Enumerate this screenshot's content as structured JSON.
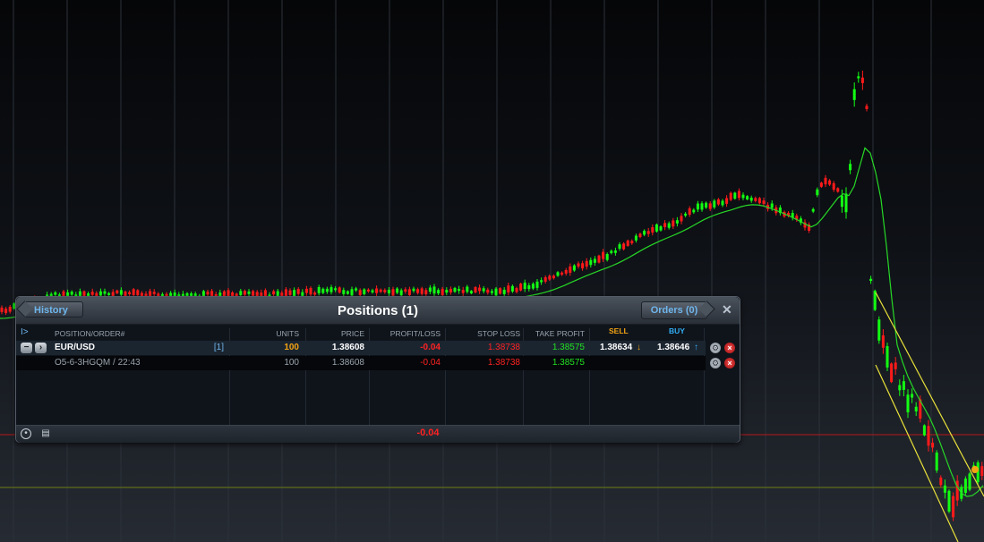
{
  "chart": {
    "background_top": "#050608",
    "background_bottom": "#262b33",
    "up_color": "#13ff13",
    "down_color": "#ff1a1a",
    "ma_color": "#27d827",
    "channel_color": "#e9e23b",
    "ref_line_red": "#c41818",
    "ref_line_olive": "#6f7d15"
  },
  "panel": {
    "history_label": "History",
    "title": "Positions (1)",
    "orders_label": "Orders (0)",
    "close_icon": "close-icon"
  },
  "columns": {
    "position_order": "POSITION/ORDER#",
    "units": "UNITS",
    "price": "PRICE",
    "profit_loss": "PROFIT/LOSS",
    "stop_loss": "STOP LOSS",
    "take_profit": "TAKE PROFIT",
    "sell": "SELL",
    "buy": "BUY"
  },
  "position": {
    "symbol": "EUR/USD",
    "count": "[1]",
    "units": "100",
    "price": "1.38608",
    "profit_loss": "-0.04",
    "stop_loss": "1.38738",
    "take_profit": "1.38575",
    "sell": "1.38634",
    "buy": "1.38646"
  },
  "order": {
    "id": "O5-6-3HGQM / 22:43",
    "units": "100",
    "price": "1.38608",
    "profit_loss": "-0.04",
    "stop_loss": "1.38738",
    "take_profit": "1.38575"
  },
  "footer": {
    "total": "-0.04",
    "settings_icon": "settings-icon",
    "print_icon": "print-icon"
  },
  "colors": {
    "sell": "#f3a312",
    "buy": "#31aef5",
    "loss": "#ff2222",
    "profit": "#22e022",
    "link": "#6fb6ec"
  }
}
